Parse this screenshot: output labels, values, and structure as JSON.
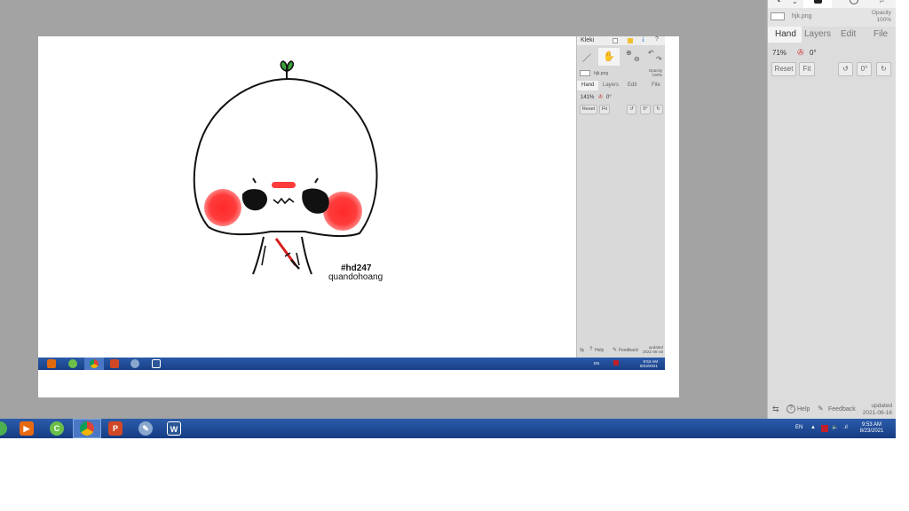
{
  "drawing": {
    "signature_line1": "#hd247",
    "signature_line2": "quandohoang"
  },
  "inner_panel": {
    "app_name": "Kleki",
    "file_name": "hjk.png",
    "opacity_label": "Opacity",
    "opacity_value": "100%",
    "tabs": [
      "Hand",
      "Layers",
      "Edit",
      "File"
    ],
    "zoom": "141%",
    "rotation": "0°",
    "reset_label": "Reset",
    "fit_label": "Fit",
    "rotate_zero_label": "0°",
    "help_label": "Help",
    "feedback_label": "Feedback",
    "updated_label": "updated",
    "updated_date": "2021-06-16"
  },
  "inner_taskbar": {
    "lang": "EN",
    "time": "9:53 AM",
    "date": "8/23/2021"
  },
  "right_panel": {
    "file_name": "hjk.png",
    "opacity_label": "Opacity",
    "opacity_value": "100%",
    "tabs": [
      "Hand",
      "Layers",
      "Edit",
      "File"
    ],
    "zoom": "71%",
    "rotation": "0°",
    "reset_label": "Reset",
    "fit_label": "Fit",
    "rotate_zero_label": "0°",
    "help_label": "Help",
    "feedback_label": "Feedback",
    "updated_label": "updated",
    "updated_date": "2021-06-16"
  },
  "taskbar": {
    "lang": "EN",
    "time": "9:53 AM",
    "date": "8/23/2021"
  },
  "colors": {
    "taskbar_blue": "#1f4c99",
    "blush": "#ff3b3b",
    "sprout": "#2e9e2e",
    "panel_gray": "#dcdcdc",
    "workspace_gray": "#a3a3a3"
  }
}
